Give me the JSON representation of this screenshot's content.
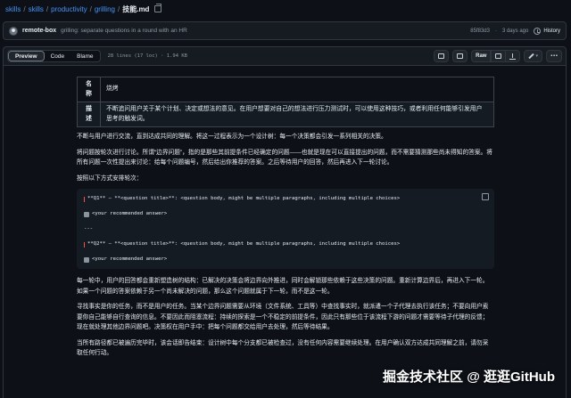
{
  "breadcrumb": {
    "items": [
      "skills",
      "skills",
      "productivity",
      "grilling"
    ],
    "current": "技能.md"
  },
  "commit": {
    "author": "remote-box",
    "message": "grilling: separate questions in a round with an HR",
    "sha": "85f83d3",
    "age": "3 days ago",
    "history_label": "History"
  },
  "toolbar": {
    "tabs": [
      "Preview",
      "Code",
      "Blame"
    ],
    "active_tab": "Preview",
    "file_info": "28 lines (17 loc) · 1.94 KB",
    "raw_label": "Raw"
  },
  "doc": {
    "table": {
      "header": [
        "名称",
        "烧烤"
      ],
      "row_key": "描述",
      "row_value": "不断追问用户关于某个计划、决定或想法的意见。在用户想要对自己的想法进行压力测试时，可以使用这种技巧，或者利用任何能够引发用户思考的触发词。"
    },
    "para1": "不断与用户进行交流，直到达成共同的理解。将这一过程表示为一个设计树：每一个决策都会引发一系列相关的决策。",
    "para2": "将问题按轮次进行讨论。所谓“边界问题”，指的是那些其前提条件已经确定的问题——也就是现在可以直接提出的问题，而不需要猜测那些尚未得知的答案。将所有问题一次性提出来讨论：给每个问题编号，然后给出你推荐的答案。之后等待用户的回答，然后再进入下一轮讨论。",
    "para3": "按照以下方式安排轮次：",
    "code": {
      "q1": "**Q1** — **<question title>**: <question body, might be multiple paragraphs, including multiple choices>",
      "a1": "<your recommended answer>",
      "divider": "---",
      "q2": "**Q2** — **<question title>**: <question body, might be multiple paragraphs, including multiple choices>",
      "a2": "<your recommended answer>"
    },
    "para4": "每一轮中，用户的回答都会重新塑造树的结构：已解决的决策会将边界向外推进，同时会解锁那些依赖于这些决策的问题。重新计算边界后，再进入下一轮。如果一个问题的答案依赖于另一个尚未解决的问题，那么这个问题就属于下一轮，而不是这一轮。",
    "para5": "寻找事实是你的任务，而不是用户的任务。当某个边界问题需要从环境（文件系统、工具等）中查找事实时，就派遣一个子代理去执行该任务；不要向用户索要你自己能够自行查询的信息。不要因此而阻塞流程：持续的探索是一个不稳定的前提条件，因此只有那些位于该流程下游的问题才需要等待子代理的反馈；现在就处理其他边界问题吧。决策权在用户手中：把每个问题都交给用户去处理，然后等待结果。",
    "para6": "当所有路径都已被遍历完毕时，该会话即告结束：设计树中每个分支都已被检查过，没有任何内容需要继续处理。在用户确认双方达成共同理解之前，请勿采取任何行动。"
  },
  "watermark": "掘金技术社区 @ 逛逛GitHub"
}
